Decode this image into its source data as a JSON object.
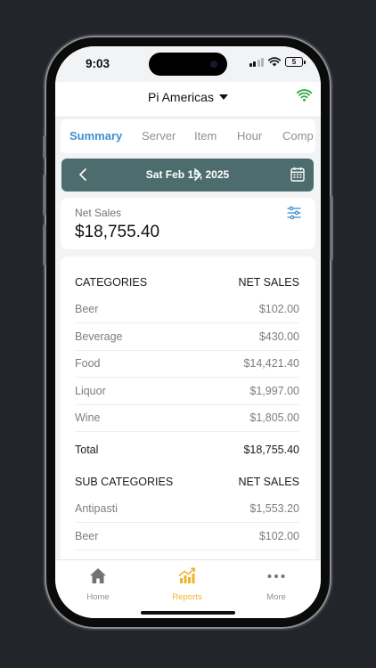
{
  "status_bar": {
    "time": "9:03",
    "battery": "5"
  },
  "header": {
    "venue": "Pi Americas"
  },
  "tabs": [
    {
      "label": "Summary",
      "active": true
    },
    {
      "label": "Server",
      "active": false
    },
    {
      "label": "Item",
      "active": false
    },
    {
      "label": "Hour",
      "active": false
    },
    {
      "label": "Comp",
      "active": false
    }
  ],
  "date_bar": {
    "date": "Sat Feb 15, 2025"
  },
  "net_sales": {
    "label": "Net Sales",
    "value": "$18,755.40"
  },
  "categories": {
    "header": "CATEGORIES",
    "value_header": "NET SALES",
    "items": [
      {
        "name": "Beer",
        "value": "$102.00"
      },
      {
        "name": "Beverage",
        "value": "$430.00"
      },
      {
        "name": "Food",
        "value": "$14,421.40"
      },
      {
        "name": "Liquor",
        "value": "$1,997.00"
      },
      {
        "name": "Wine",
        "value": "$1,805.00"
      }
    ],
    "total_label": "Total",
    "total_value": "$18,755.40"
  },
  "sub_categories": {
    "header": "SUB CATEGORIES",
    "value_header": "NET SALES",
    "items": [
      {
        "name": "Antipasti",
        "value": "$1,553.20"
      },
      {
        "name": "Beer",
        "value": "$102.00"
      }
    ]
  },
  "tab_bar": {
    "items": [
      {
        "label": "Home",
        "active": false
      },
      {
        "label": "Reports",
        "active": true
      },
      {
        "label": "More",
        "active": false
      }
    ]
  },
  "colors": {
    "accent": "#3d90d0",
    "date_bar": "#4d6c6e",
    "active_tab_bar": "#f0b429",
    "wifi_green": "#2fa845"
  }
}
